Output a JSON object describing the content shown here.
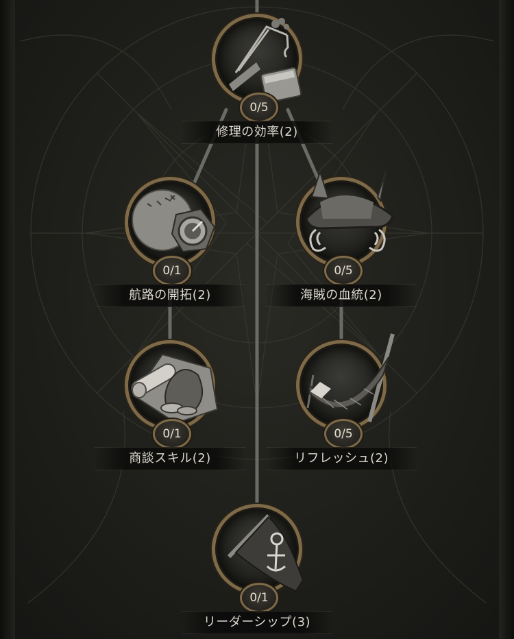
{
  "skills": [
    {
      "name": "修理の効率(2)",
      "level": "0/5",
      "icon": "crane-hook-anvil-icon"
    },
    {
      "name": "航路の開拓(2)",
      "level": "0/1",
      "icon": "map-compass-icon"
    },
    {
      "name": "海賊の血統(2)",
      "level": "0/5",
      "icon": "horned-pirate-hat-icon"
    },
    {
      "name": "商談スキル(2)",
      "level": "0/1",
      "icon": "scroll-coin-bag-icon"
    },
    {
      "name": "リフレッシュ(2)",
      "level": "0/5",
      "icon": "hammock-icon"
    },
    {
      "name": "リーダーシップ(3)",
      "level": "0/1",
      "icon": "pirate-flag-icon"
    }
  ],
  "colors": {
    "background": "#1c1c19",
    "ring_gold": "#7e6a48",
    "connector": "#6b6b66",
    "text": "#dcd8cf"
  }
}
